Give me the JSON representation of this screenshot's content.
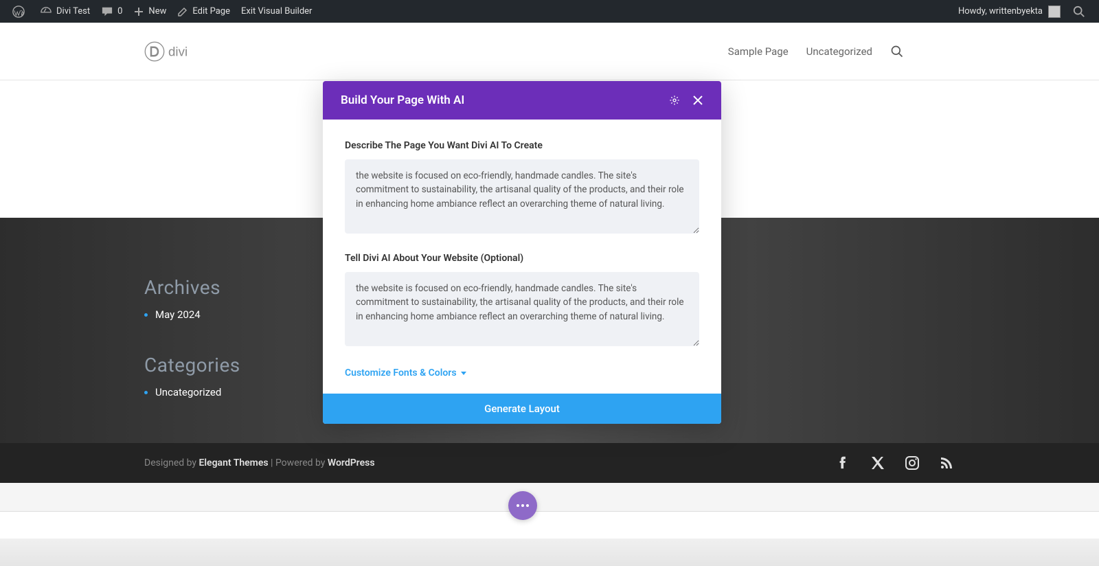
{
  "adminBar": {
    "siteName": "Divi Test",
    "commentsCount": "0",
    "newLabel": "New",
    "editPage": "Edit Page",
    "exitBuilder": "Exit Visual Builder",
    "howdy": "Howdy, writtenbyekta"
  },
  "header": {
    "logoText": "divi",
    "nav": {
      "samplePage": "Sample Page",
      "uncategorized": "Uncategorized"
    }
  },
  "sidebar": {
    "archives": {
      "title": "Archives",
      "item": "May 2024"
    },
    "categories": {
      "title": "Categories",
      "item": "Uncategorized"
    }
  },
  "footer": {
    "designedBy": "Designed by ",
    "elegantThemes": "Elegant Themes",
    "poweredBy": " | Powered by ",
    "wordpress": "WordPress"
  },
  "modal": {
    "title": "Build Your Page With AI",
    "field1Label": "Describe The Page You Want Divi AI To Create",
    "field1Value": "the website is focused on eco-friendly, handmade candles. The site's commitment to sustainability, the artisanal quality of the products, and their role in enhancing home ambiance reflect an overarching theme of natural living.",
    "field2Label": "Tell Divi AI About Your Website (Optional)",
    "field2Value": "the website is focused on eco-friendly, handmade candles. The site's commitment to sustainability, the artisanal quality of the products, and their role in enhancing home ambiance reflect an overarching theme of natural living.",
    "customizeLink": "Customize Fonts & Colors",
    "generateButton": "Generate Layout"
  }
}
